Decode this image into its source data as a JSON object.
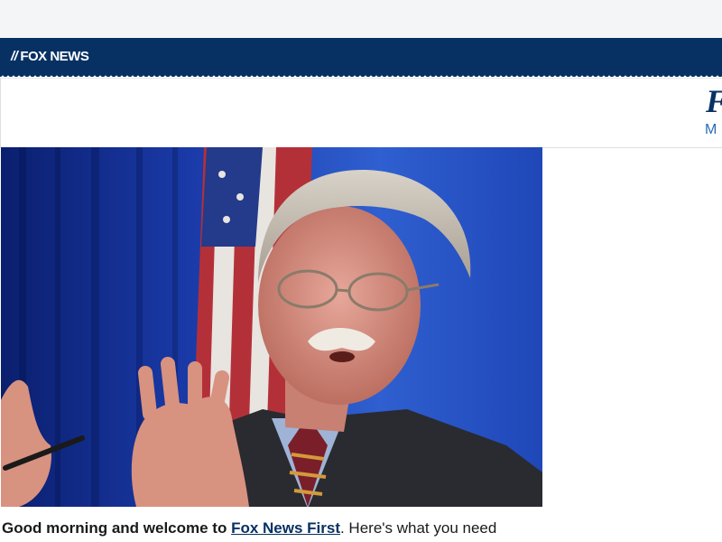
{
  "brand": {
    "logo_mark": "//",
    "logo_text": "FOX NEWS"
  },
  "header": {
    "title_initial": "F",
    "subtitle_initial": "M"
  },
  "article": {
    "intro_bold": "Good morning and welcome to ",
    "intro_link": "Fox News First",
    "intro_rest": ". Here's what you need"
  },
  "colors": {
    "brand_navy": "#073163",
    "link_blue": "#2a6bb5",
    "top_bar": "#f4f5f6"
  }
}
